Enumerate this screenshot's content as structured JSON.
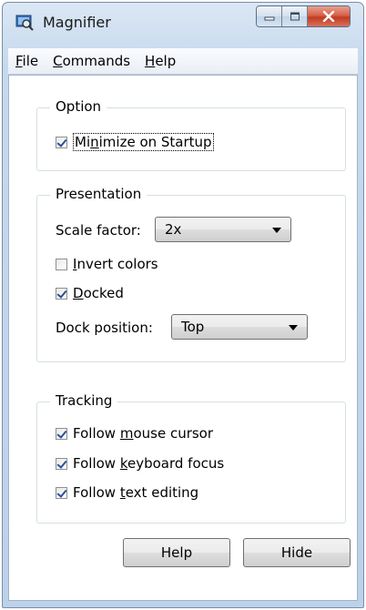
{
  "window": {
    "title": "Magnifier",
    "caption_buttons": [
      "minimize-icon",
      "maximize-icon",
      "close-icon"
    ]
  },
  "menu": {
    "items": [
      {
        "label_pre": "",
        "mnemonic": "F",
        "label_post": "ile"
      },
      {
        "label_pre": "",
        "mnemonic": "C",
        "label_post": "ommands"
      },
      {
        "label_pre": "",
        "mnemonic": "H",
        "label_post": "elp"
      }
    ]
  },
  "option": {
    "group_label": "Option",
    "minimize": {
      "label_pre": "Mi",
      "mnemonic": "n",
      "label_post": "imize on Startup",
      "checked": true
    }
  },
  "presentation": {
    "group_label": "Presentation",
    "scale_label": "Scale factor:",
    "scale_value": "2x",
    "invert": {
      "label_pre": "",
      "mnemonic": "I",
      "label_post": "nvert colors",
      "checked": false
    },
    "docked": {
      "label_pre": "",
      "mnemonic": "D",
      "label_post": "ocked",
      "checked": true
    },
    "dock_label": "Dock position:",
    "dock_value": "Top"
  },
  "tracking": {
    "group_label": "Tracking",
    "mouse": {
      "label_pre": "Follow ",
      "mnemonic": "m",
      "label_post": "ouse cursor",
      "checked": true
    },
    "keyboard": {
      "label_pre": "Follow ",
      "mnemonic": "k",
      "label_post": "eyboard focus",
      "checked": true
    },
    "text": {
      "label_pre": "Follow ",
      "mnemonic": "t",
      "label_post": "ext editing",
      "checked": true
    }
  },
  "buttons": {
    "help": "Help",
    "hide": "Hide"
  }
}
